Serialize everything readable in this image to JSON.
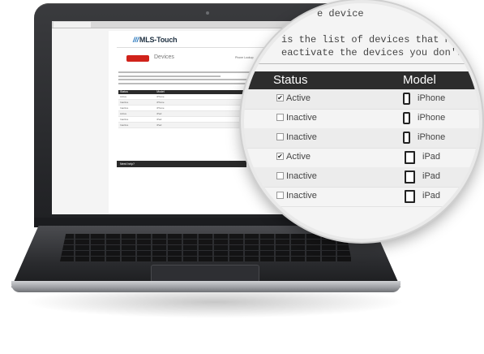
{
  "browser": {
    "tab_label": ""
  },
  "site": {
    "logo_text": "MLS-Touch",
    "portal_label": "MOBILE PORTAL",
    "home_button": "",
    "page_title": "Devices",
    "management_label": "Phone Lookup"
  },
  "help": {
    "label": "Need help?",
    "contact": ""
  },
  "magnified": {
    "title": "e device",
    "line1": "is the list of devices that have",
    "line2": "eactivate the devices you don't use any",
    "columns": {
      "status": "Status",
      "model": "Model"
    },
    "rows": [
      {
        "checked": true,
        "status": "Active",
        "model": "iPhone",
        "icon": "smartphone-icon"
      },
      {
        "checked": false,
        "status": "Inactive",
        "model": "iPhone",
        "icon": "smartphone-icon"
      },
      {
        "checked": false,
        "status": "Inactive",
        "model": "iPhone",
        "icon": "smartphone-icon"
      },
      {
        "checked": true,
        "status": "Active",
        "model": "iPad",
        "icon": "tablet-icon"
      },
      {
        "checked": false,
        "status": "Inactive",
        "model": "iPad",
        "icon": "tablet-icon"
      },
      {
        "checked": false,
        "status": "Inactive",
        "model": "iPad",
        "icon": "tablet-icon"
      }
    ]
  }
}
